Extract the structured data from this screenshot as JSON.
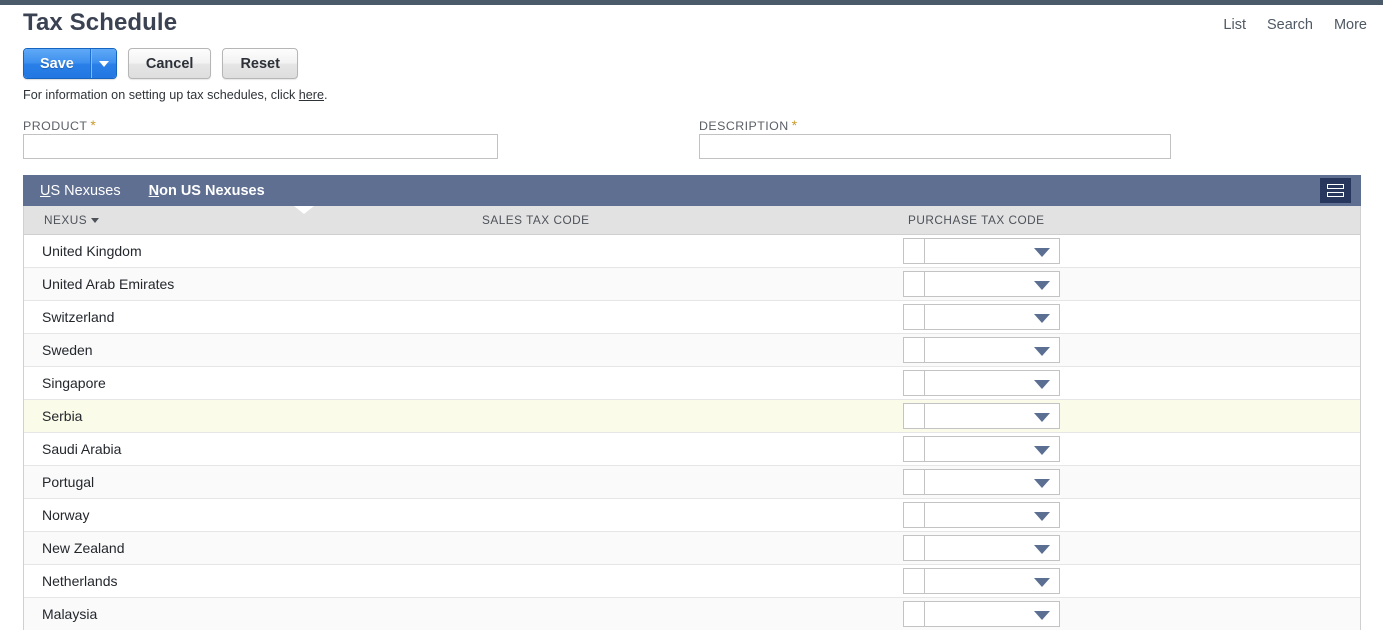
{
  "header": {
    "title": "Tax Schedule",
    "nav": [
      {
        "label": "List",
        "name": "nav-list"
      },
      {
        "label": "Search",
        "name": "nav-search"
      },
      {
        "label": "More",
        "name": "nav-more"
      }
    ]
  },
  "toolbar": {
    "save_label": "Save",
    "save_caret_icon": "chevron-down-icon",
    "cancel_label": "Cancel",
    "reset_label": "Reset"
  },
  "help": {
    "text_before": "For information on setting up tax schedules, click ",
    "link_label": "here",
    "text_after": "."
  },
  "fields": {
    "product": {
      "label": "PRODUCT",
      "required_marker": "*",
      "value": "",
      "placeholder": ""
    },
    "description": {
      "label": "DESCRIPTION",
      "required_marker": "*",
      "value": "",
      "placeholder": ""
    }
  },
  "tabs": [
    {
      "label": "US Nexuses",
      "mnemonic": "U",
      "rest": "S Nexuses",
      "active": false
    },
    {
      "label": "Non US Nexuses",
      "mnemonic": "N",
      "rest": "on US Nexuses",
      "active": true
    }
  ],
  "view_button": {
    "icon": "list-view-icon",
    "label": ""
  },
  "table": {
    "columns": [
      {
        "label": "NEXUS",
        "sorted": true,
        "sort_icon": "caret-down-icon"
      },
      {
        "label": "SALES TAX CODE",
        "sorted": false
      },
      {
        "label": "PURCHASE TAX CODE",
        "sorted": false
      }
    ],
    "rows": [
      {
        "nexus": "United Kingdom",
        "sales_tax_code": "",
        "purchase_tax_code": "",
        "selected": false
      },
      {
        "nexus": "United Arab Emirates",
        "sales_tax_code": "",
        "purchase_tax_code": "",
        "selected": false
      },
      {
        "nexus": "Switzerland",
        "sales_tax_code": "",
        "purchase_tax_code": "",
        "selected": false
      },
      {
        "nexus": "Sweden",
        "sales_tax_code": "",
        "purchase_tax_code": "",
        "selected": false
      },
      {
        "nexus": "Singapore",
        "sales_tax_code": "",
        "purchase_tax_code": "",
        "selected": false
      },
      {
        "nexus": "Serbia",
        "sales_tax_code": "",
        "purchase_tax_code": "",
        "selected": true
      },
      {
        "nexus": "Saudi Arabia",
        "sales_tax_code": "",
        "purchase_tax_code": "",
        "selected": false
      },
      {
        "nexus": "Portugal",
        "sales_tax_code": "",
        "purchase_tax_code": "",
        "selected": false
      },
      {
        "nexus": "Norway",
        "sales_tax_code": "",
        "purchase_tax_code": "",
        "selected": false
      },
      {
        "nexus": "New Zealand",
        "sales_tax_code": "",
        "purchase_tax_code": "",
        "selected": false
      },
      {
        "nexus": "Netherlands",
        "sales_tax_code": "",
        "purchase_tax_code": "",
        "selected": false
      },
      {
        "nexus": "Malaysia",
        "sales_tax_code": "",
        "purchase_tax_code": "",
        "selected": false
      }
    ]
  },
  "colors": {
    "tabbar": "#5f6f91",
    "primary_button": "#2a80e8",
    "selected_row": "#fbfbe9",
    "header_row": "#e2e2e2",
    "required_marker": "#c99a2e",
    "top_strip": "#4a5a68"
  }
}
